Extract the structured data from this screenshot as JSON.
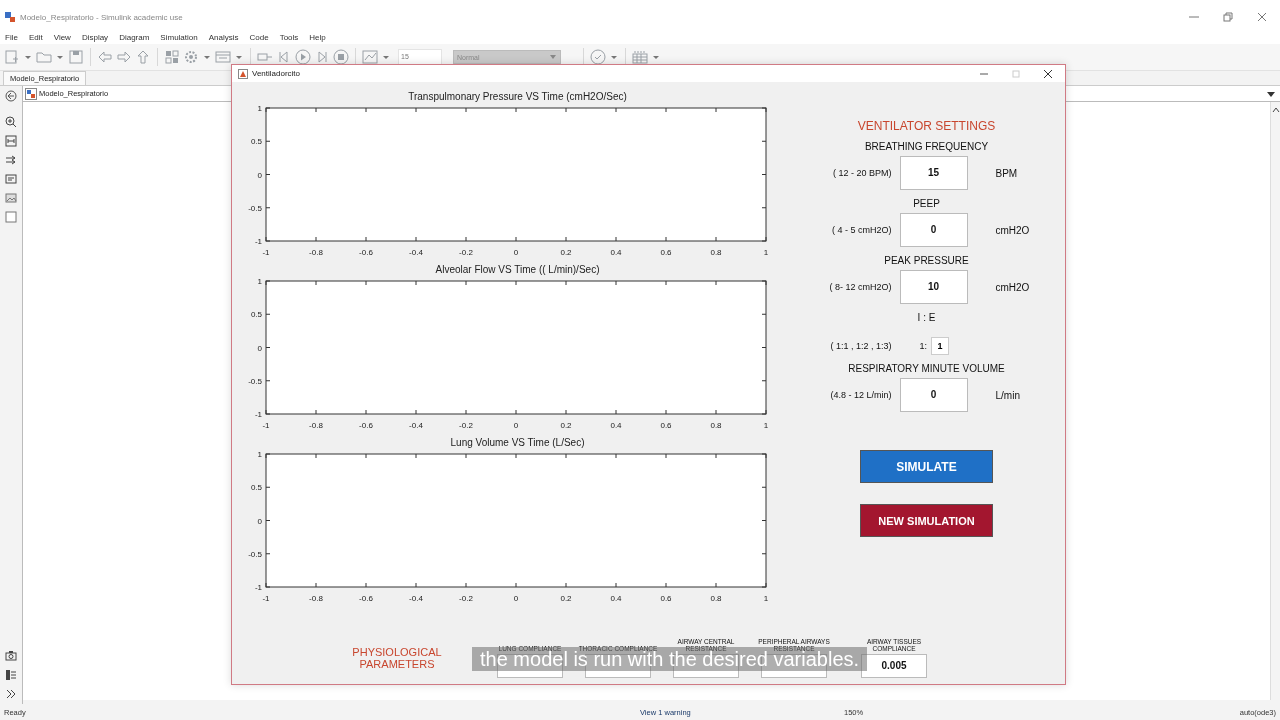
{
  "app": {
    "title": "Modelo_Respiratorio - Simulink academic use",
    "menu": [
      "File",
      "Edit",
      "View",
      "Display",
      "Diagram",
      "Simulation",
      "Analysis",
      "Code",
      "Tools",
      "Help"
    ],
    "toolbar": {
      "stop_time": "15",
      "mode": "Normal"
    },
    "tabs": [
      {
        "label": "Modelo_Respiratorio",
        "selected": true
      }
    ],
    "breadcrumb": "Modelo_Respiratorio"
  },
  "figure": {
    "title": "Ventiladorcito",
    "plots": [
      {
        "chart_data": {
          "type": "line",
          "title": "Transpulmonary Pressure VS Time (cmH2O/Sec)",
          "xlim": [
            -1,
            1
          ],
          "ylim": [
            -1,
            1
          ],
          "xticks": [
            -1,
            -0.8,
            -0.6,
            -0.4,
            -0.2,
            0,
            0.2,
            0.4,
            0.6,
            0.8,
            1
          ],
          "yticks": [
            -1,
            -0.5,
            0,
            0.5,
            1
          ]
        }
      },
      {
        "chart_data": {
          "type": "line",
          "title": "Alveolar Flow VS Time (( L/min)/Sec)",
          "xlim": [
            -1,
            1
          ],
          "ylim": [
            -1,
            1
          ],
          "xticks": [
            -1,
            -0.8,
            -0.6,
            -0.4,
            -0.2,
            0,
            0.2,
            0.4,
            0.6,
            0.8,
            1
          ],
          "yticks": [
            -1,
            -0.5,
            0,
            0.5,
            1
          ]
        }
      },
      {
        "chart_data": {
          "type": "line",
          "title": "Lung Volume VS Time (L/Sec)",
          "xlim": [
            -1,
            1
          ],
          "ylim": [
            -1,
            1
          ],
          "xticks": [
            -1,
            -0.8,
            -0.6,
            -0.4,
            -0.2,
            0,
            0.2,
            0.4,
            0.6,
            0.8,
            1
          ],
          "yticks": [
            -1,
            -0.5,
            0,
            0.5,
            1
          ]
        }
      }
    ],
    "settings": {
      "title": "VENTILATOR SETTINGS",
      "items": [
        {
          "kind": "field",
          "label": "BREATHING FREQUENCY",
          "range": "( 12 - 20 BPM)",
          "value": "15",
          "unit": "BPM"
        },
        {
          "kind": "field",
          "label": "PEEP",
          "range": "( 4 - 5 cmH2O)",
          "value": "0",
          "unit": "cmH2O"
        },
        {
          "kind": "field",
          "label": "PEAK PRESSURE",
          "range": "( 8- 12 cmH2O)",
          "value": "10",
          "unit": "cmH2O"
        },
        {
          "kind": "ratio",
          "label": "I : E",
          "range": "( 1:1 , 1:2 , 1:3)",
          "prefix": "1:",
          "value": "1"
        },
        {
          "kind": "field",
          "label": "RESPIRATORY MINUTE VOLUME",
          "range": "(4.8 - 12 L/min)",
          "value": "0",
          "unit": "L/min"
        }
      ]
    },
    "buttons": [
      {
        "label": "SIMULATE",
        "kind": "primary"
      },
      {
        "label": "NEW SIMULATION",
        "kind": "danger"
      }
    ],
    "physiological": {
      "title": "PHYSIOLOGICAL PARAMETERS",
      "params": [
        {
          "label": "LUNG COMPLIANCE"
        },
        {
          "label": "THORACIC COMPLIANCE"
        },
        {
          "label": "AIRWAY CENTRAL RESISTANCE"
        },
        {
          "label": "PERIPHERAL AIRWAYS RESISTANCE"
        },
        {
          "label": "AIRWAY TISSUES COMPLIANCE",
          "value": "0.005"
        }
      ]
    }
  },
  "caption": "the model is run with the desired variables.",
  "status_bar": {
    "left": "Ready",
    "center": "View 1 warning",
    "zoom": "150%",
    "solver": "auto(ode3)"
  }
}
